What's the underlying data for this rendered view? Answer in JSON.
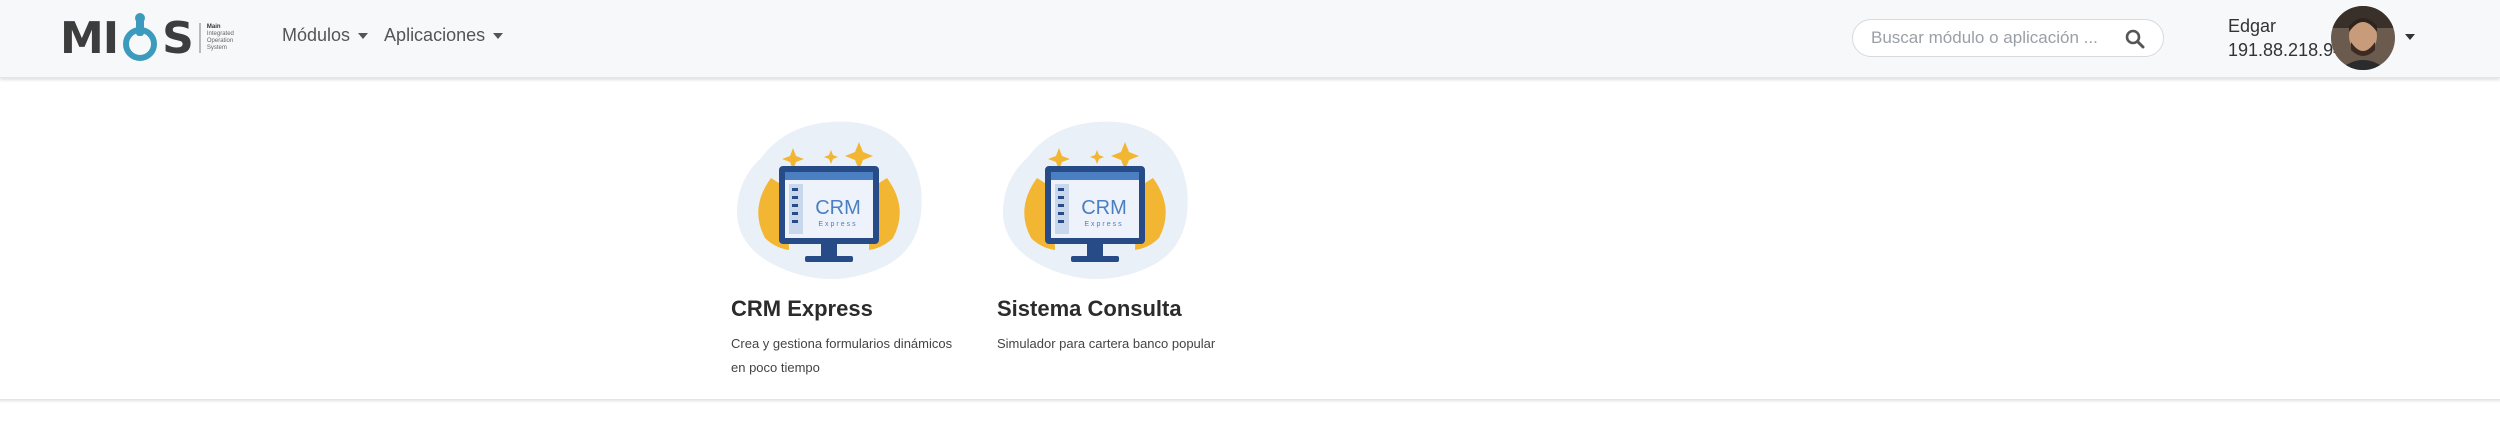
{
  "brand": {
    "logo_m": "MI",
    "logo_s": "S",
    "subtitle": [
      "Main",
      "Integrated",
      "Operation",
      "System"
    ]
  },
  "nav": {
    "items": [
      {
        "label": "Módulos"
      },
      {
        "label": "Aplicaciones"
      }
    ]
  },
  "search": {
    "placeholder": "Buscar módulo o aplicación ..."
  },
  "user": {
    "name": "Edgar",
    "ip": "191.88.218.94"
  },
  "apps": [
    {
      "title": "CRM Express",
      "description": "Crea y gestiona formularios dinámicos en poco tiempo",
      "badge_main": "CRM",
      "badge_sub": "Express"
    },
    {
      "title": "Sistema Consulta",
      "description": "Simulador para cartera banco popular",
      "badge_main": "CRM",
      "badge_sub": "Express"
    }
  ],
  "colors": {
    "accent": "#4a7fc1",
    "gold": "#f2b632",
    "navbar_bg": "#f7f8fa"
  }
}
